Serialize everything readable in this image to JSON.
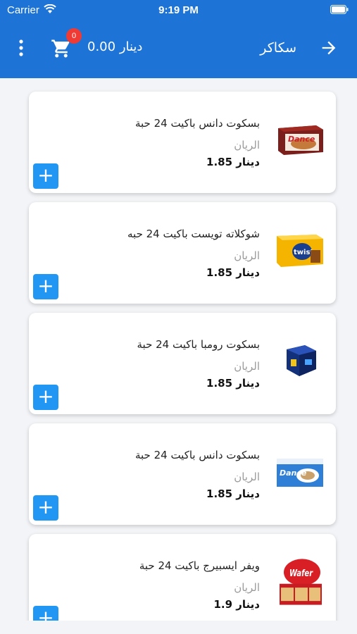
{
  "status_bar": {
    "carrier": "Carrier",
    "time": "9:19 PM"
  },
  "header": {
    "title": "سكاكر",
    "cart_total": "0.00 دينار",
    "cart_count": "0",
    "accent": "#1d74d6"
  },
  "products": [
    {
      "name": "بسكوت دانس باكيت 24 حبة",
      "brand": "الريان",
      "price": "1.85 دينار",
      "image": "dance-biscuit-box"
    },
    {
      "name": "شوكلاته تويست باكيت 24 حبه",
      "brand": "الريان",
      "price": "1.85 دينار",
      "image": "twist-chocolate-box"
    },
    {
      "name": "بسكوت رومبا باكيت 24 حبة",
      "brand": "الريان",
      "price": "1.85 دينار",
      "image": "rumba-biscuit-box"
    },
    {
      "name": "بسكوت دانس باكيت 24 حبة",
      "brand": "الريان",
      "price": "1.85 دينار",
      "image": "dance-milk-biscuit-box"
    },
    {
      "name": "ويفر ايسبيرج باكيت 24 حبة",
      "brand": "الريان",
      "price": "1.9 دينار",
      "image": "wafer-box"
    }
  ],
  "add_label": "+"
}
